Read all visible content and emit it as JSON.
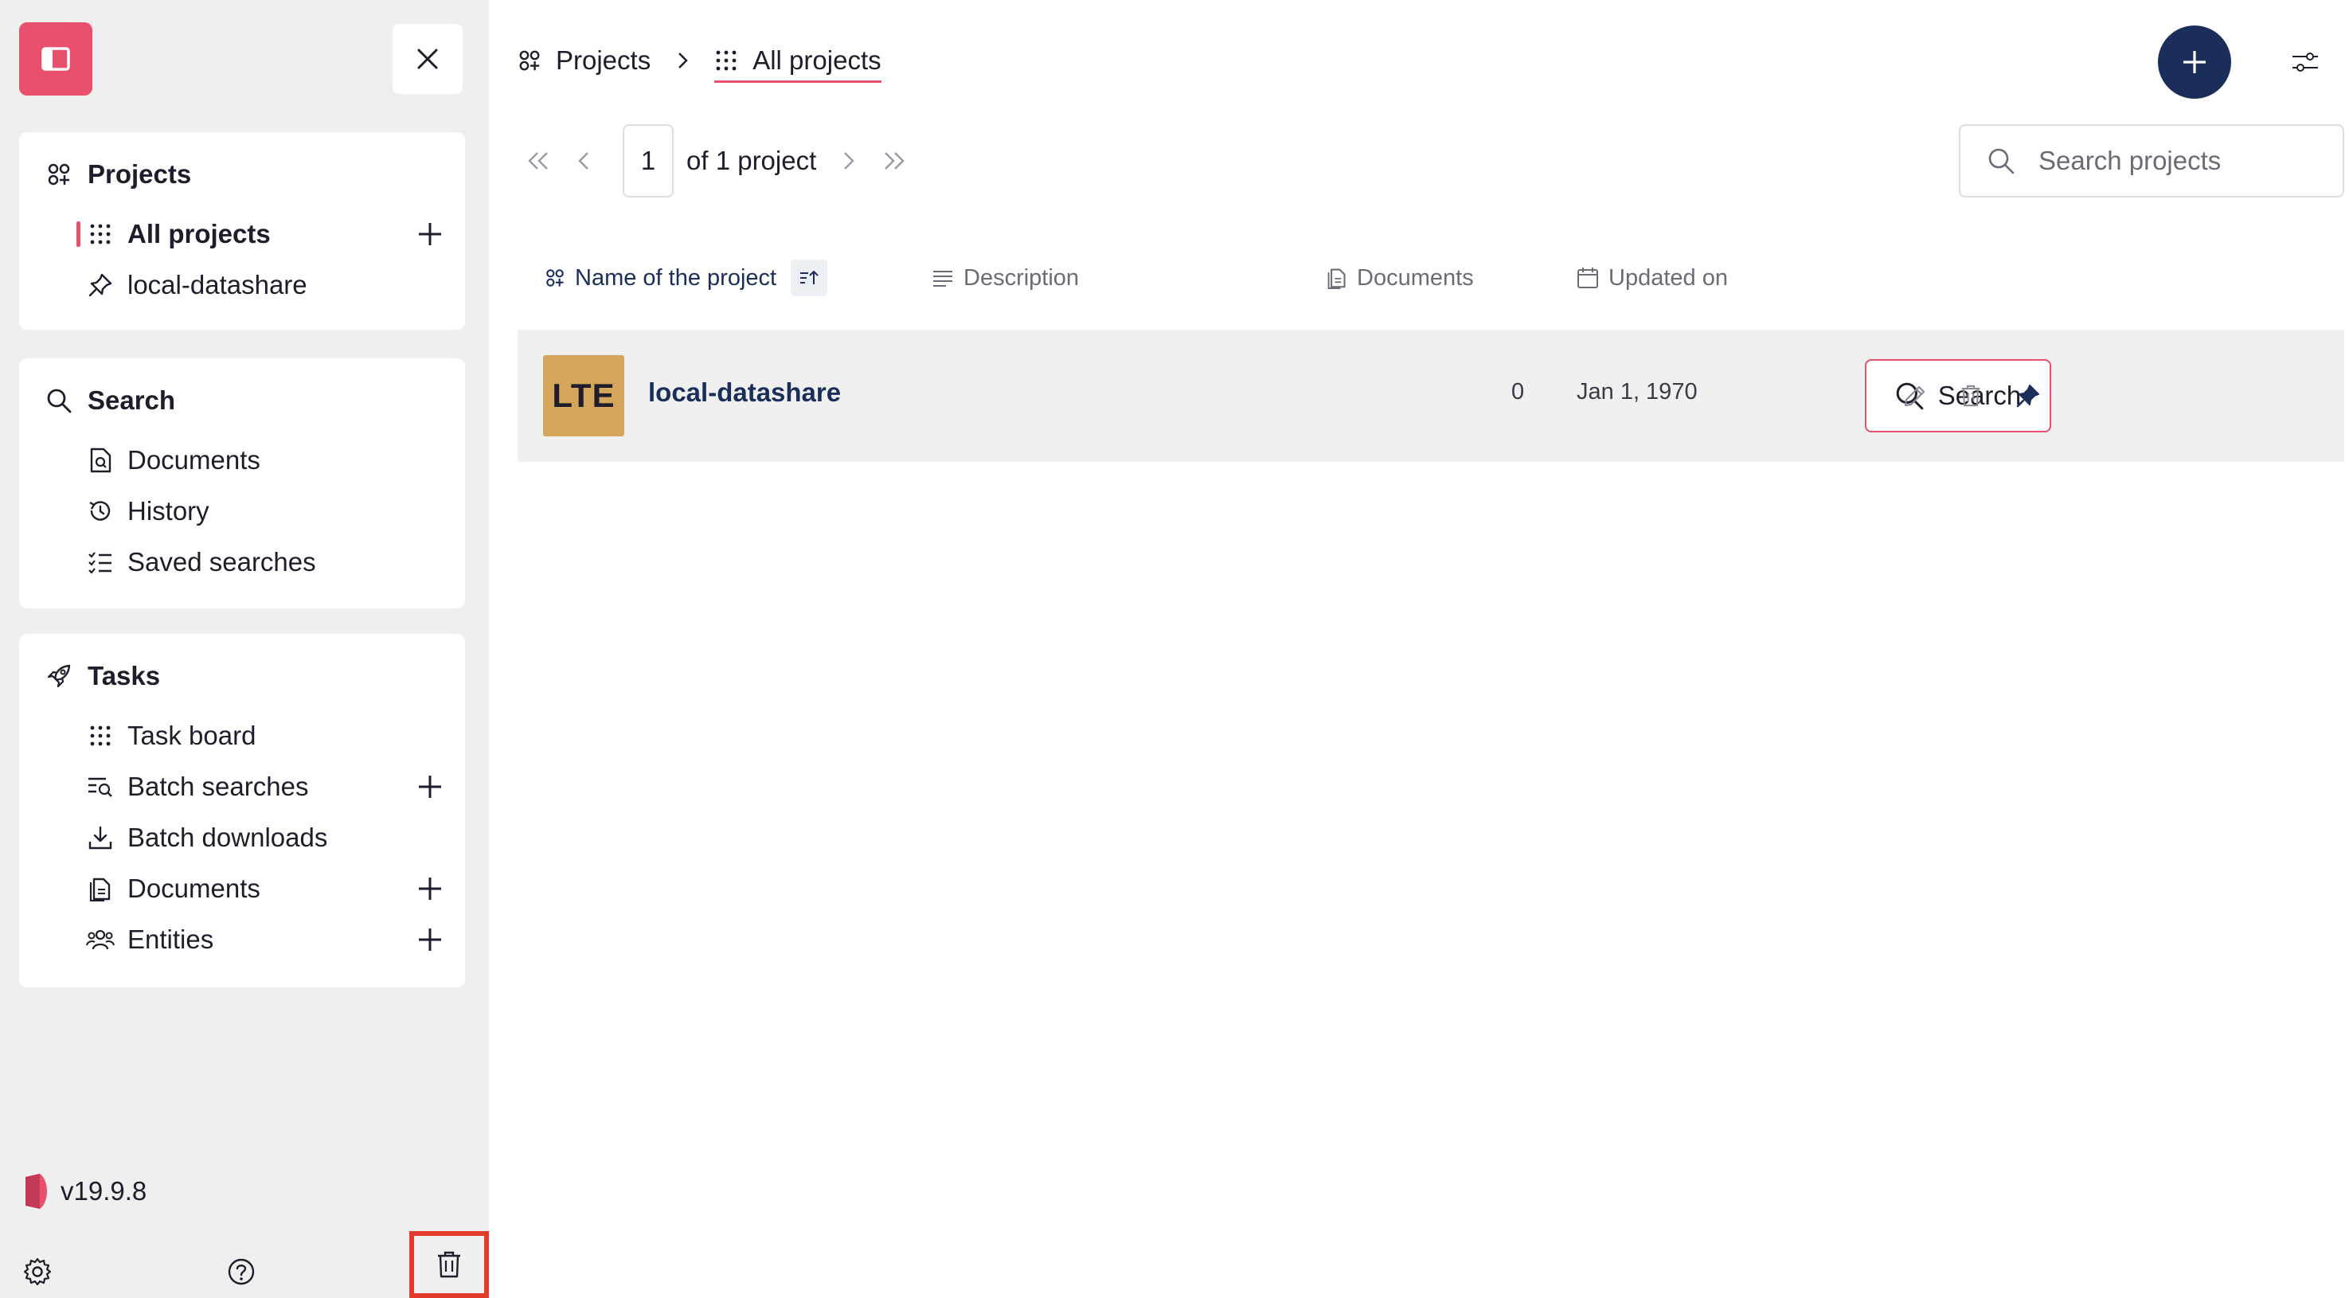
{
  "sidebar": {
    "projects": {
      "title": "Projects",
      "items": [
        {
          "label": "All projects",
          "icon": "grid-dots-icon",
          "active": true
        },
        {
          "label": "local-datashare",
          "icon": "pin-icon"
        }
      ]
    },
    "search": {
      "title": "Search",
      "items": [
        {
          "label": "Documents",
          "icon": "document-search-icon"
        },
        {
          "label": "History",
          "icon": "history-icon"
        },
        {
          "label": "Saved searches",
          "icon": "list-checks-icon"
        }
      ]
    },
    "tasks": {
      "title": "Tasks",
      "items": [
        {
          "label": "Task board",
          "icon": "grid-dots-icon"
        },
        {
          "label": "Batch searches",
          "icon": "list-search-icon"
        },
        {
          "label": "Batch downloads",
          "icon": "download-icon"
        },
        {
          "label": "Documents",
          "icon": "documents-icon"
        },
        {
          "label": "Entities",
          "icon": "users-icon"
        }
      ]
    },
    "version": "v19.9.8"
  },
  "breadcrumb": {
    "root": "Projects",
    "current": "All projects"
  },
  "pager": {
    "page": "1",
    "total_text": "of 1 project"
  },
  "search": {
    "placeholder": "Search projects"
  },
  "table": {
    "columns": {
      "name": "Name of the project",
      "description": "Description",
      "documents": "Documents",
      "updated": "Updated on"
    },
    "rows": [
      {
        "initials": "LTE",
        "name": "local-datashare",
        "documents": "0",
        "updated": "Jan 1, 1970",
        "search_label": "Search"
      }
    ]
  },
  "colors": {
    "accent": "#e8506d",
    "navy": "#1b2e59",
    "avatar": "#d4a55b",
    "highlight": "#e33b2b"
  }
}
